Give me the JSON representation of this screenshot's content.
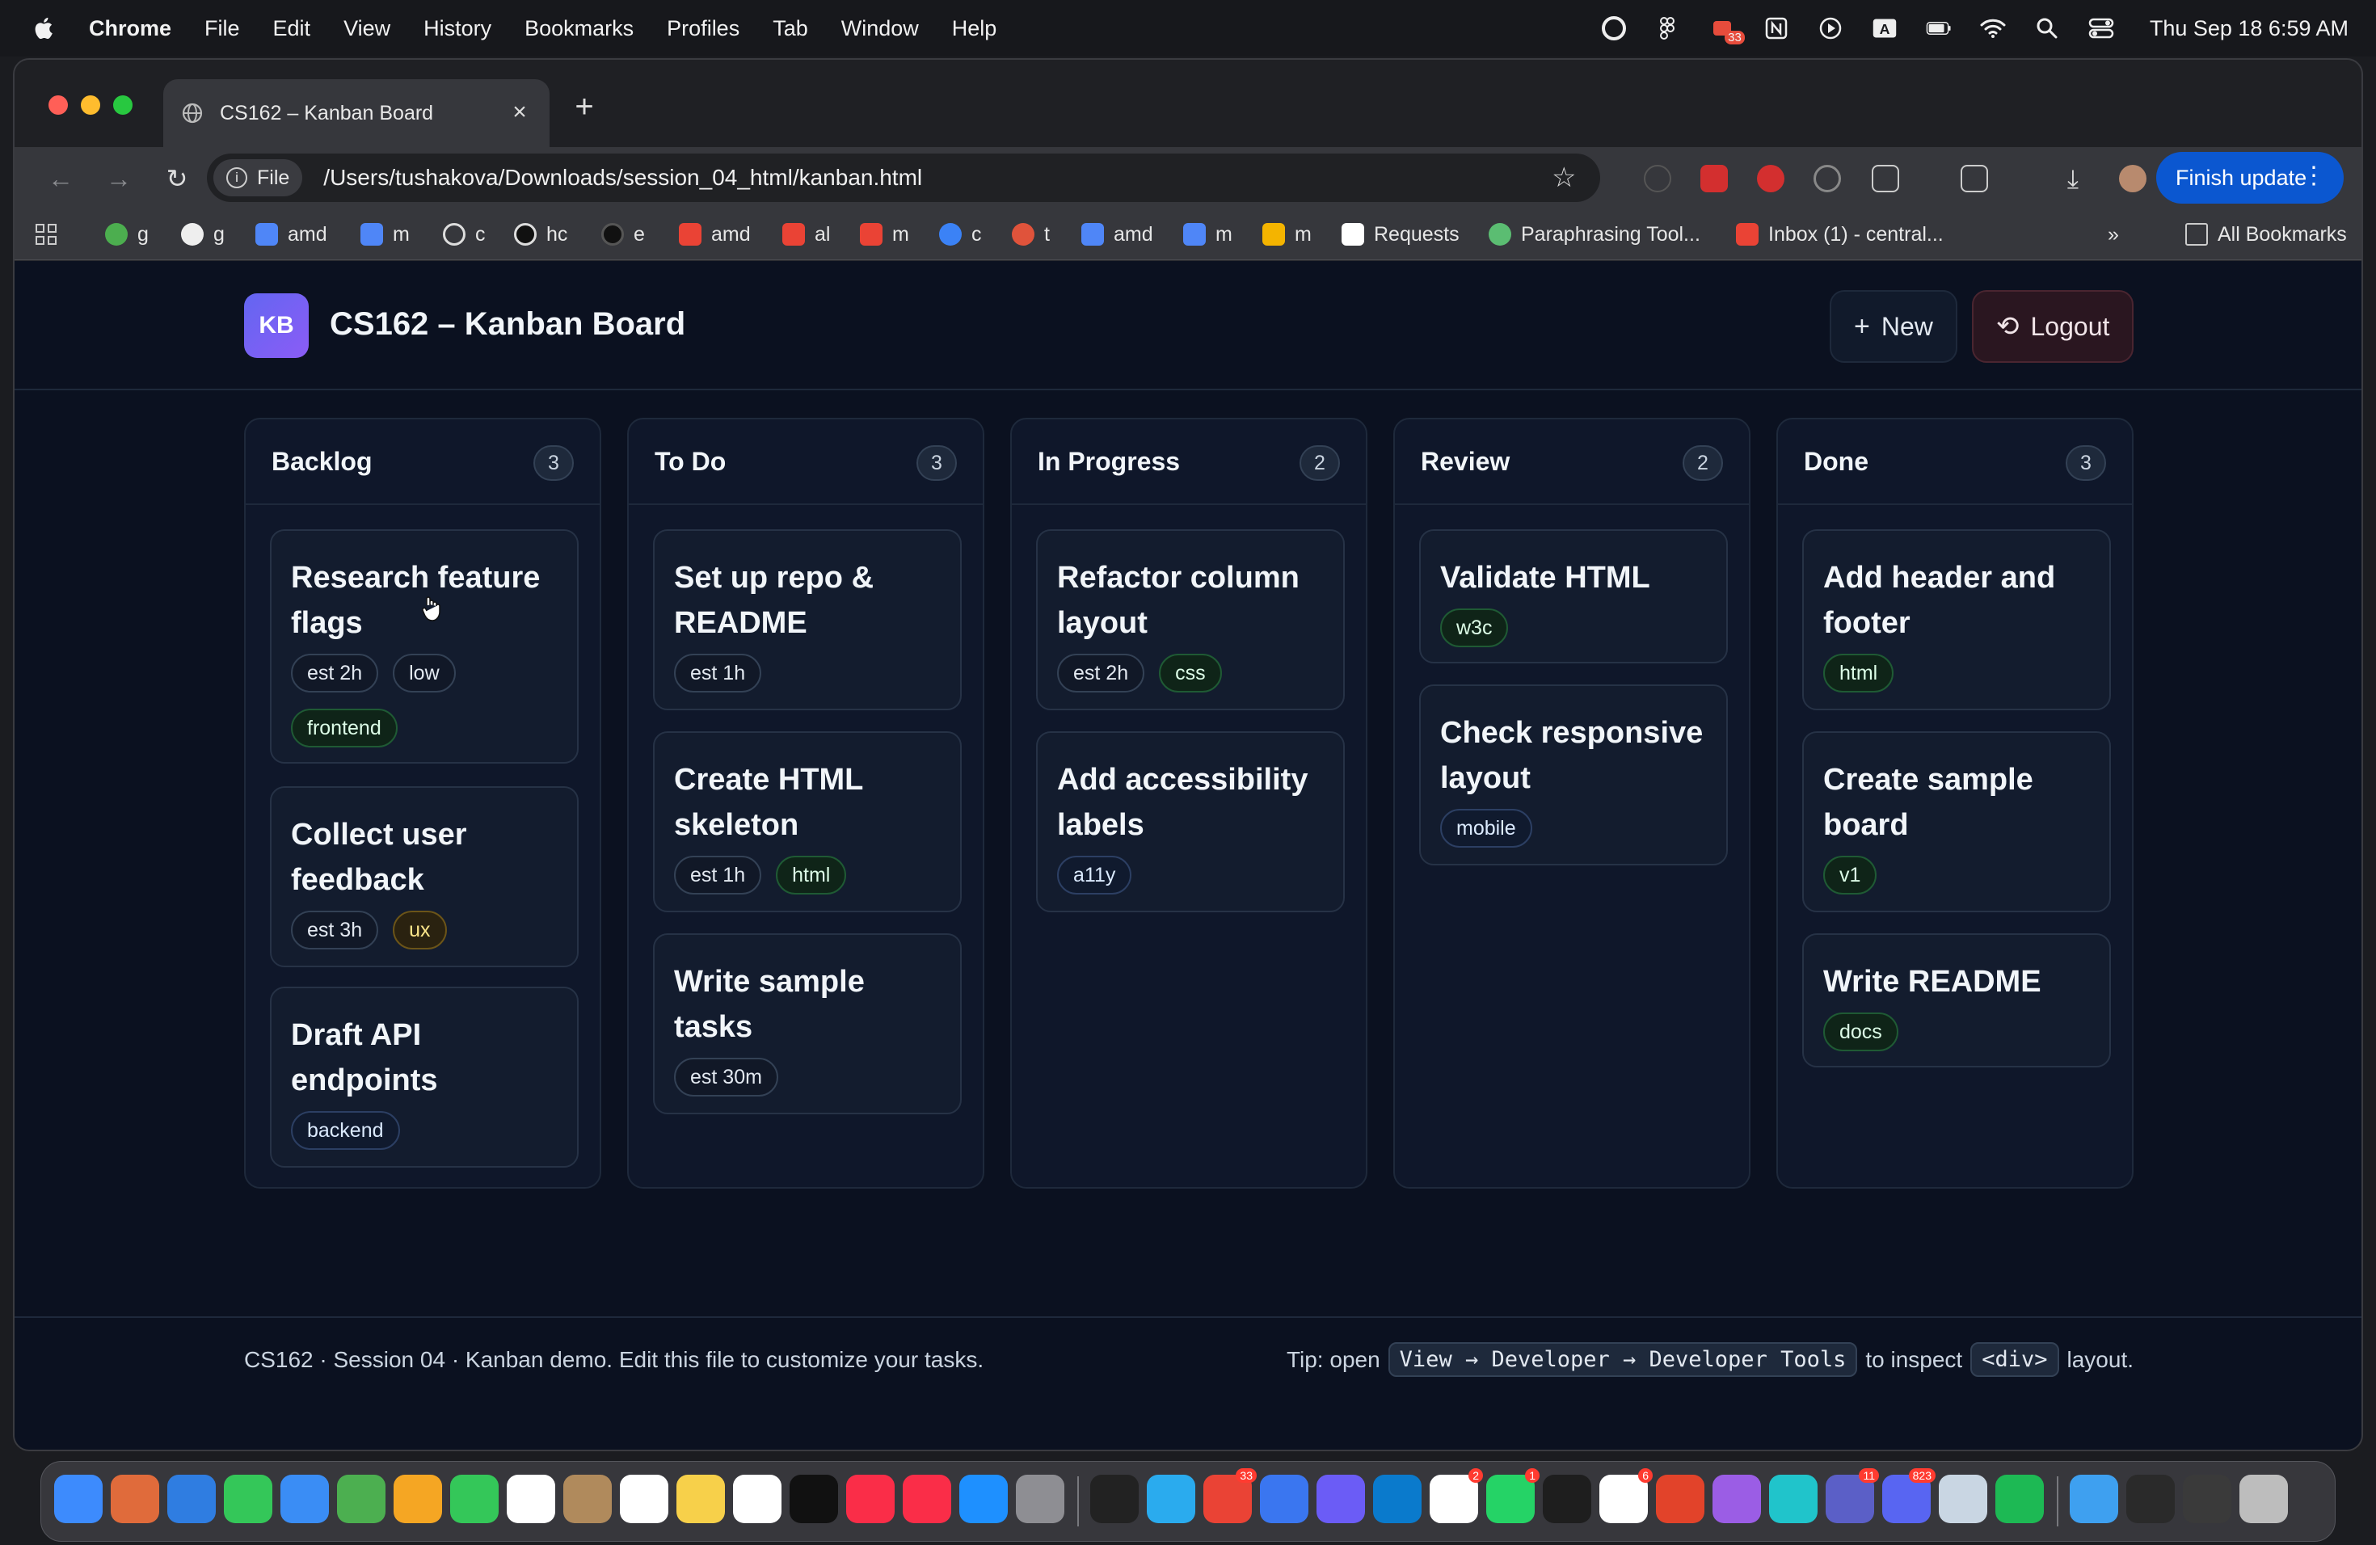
{
  "menubar": {
    "app": "Chrome",
    "items": [
      "File",
      "Edit",
      "View",
      "History",
      "Bookmarks",
      "Profiles",
      "Tab",
      "Window",
      "Help"
    ],
    "clock": "Thu Sep 18  6:59 AM",
    "status_badge": "33"
  },
  "browser": {
    "tab_title": "CS162 – Kanban Board",
    "chip_label": "File",
    "url": "/Users/tushakova/Downloads/session_04_html/kanban.html",
    "finish_update_label": "Finish update",
    "bookmarks": [
      "g",
      "g",
      "amd",
      "m",
      "c",
      "hc",
      "e",
      "amd",
      "al",
      "m",
      "c",
      "t",
      "amd",
      "m",
      "m",
      "Requests",
      "Paraphrasing Tool...",
      "Inbox (1) - central..."
    ],
    "all_bookmarks_label": "All Bookmarks"
  },
  "app": {
    "logo_text": "KB",
    "title": "CS162 – Kanban Board",
    "new_button": "New",
    "logout_button": "Logout"
  },
  "columns": [
    {
      "title": "Backlog",
      "count": "3",
      "cards": [
        {
          "title": "Research feature flags",
          "tags": [
            {
              "text": "est 2h",
              "style": "plain"
            },
            {
              "text": "low",
              "style": "plain"
            },
            {
              "text": "frontend",
              "style": "green"
            }
          ]
        },
        {
          "title": "Collect user feedback",
          "tags": [
            {
              "text": "est 3h",
              "style": "plain"
            },
            {
              "text": "ux",
              "style": "amber"
            }
          ]
        },
        {
          "title": "Draft API endpoints",
          "tags": [
            {
              "text": "backend",
              "style": "blue"
            }
          ]
        }
      ]
    },
    {
      "title": "To Do",
      "count": "3",
      "cards": [
        {
          "title": "Set up repo & README",
          "tags": [
            {
              "text": "est 1h",
              "style": "plain"
            }
          ]
        },
        {
          "title": "Create HTML skeleton",
          "tags": [
            {
              "text": "est 1h",
              "style": "plain"
            },
            {
              "text": "html",
              "style": "green"
            }
          ]
        },
        {
          "title": "Write sample tasks",
          "tags": [
            {
              "text": "est 30m",
              "style": "plain"
            }
          ]
        }
      ]
    },
    {
      "title": "In Progress",
      "count": "2",
      "cards": [
        {
          "title": "Refactor column layout",
          "tags": [
            {
              "text": "est 2h",
              "style": "plain"
            },
            {
              "text": "css",
              "style": "green"
            }
          ]
        },
        {
          "title": "Add accessibility labels",
          "tags": [
            {
              "text": "a11y",
              "style": "blue"
            }
          ]
        }
      ]
    },
    {
      "title": "Review",
      "count": "2",
      "cards": [
        {
          "title": "Validate HTML",
          "tags": [
            {
              "text": "w3c",
              "style": "green"
            }
          ]
        },
        {
          "title": "Check responsive layout",
          "tags": [
            {
              "text": "mobile",
              "style": "blue"
            }
          ]
        }
      ]
    },
    {
      "title": "Done",
      "count": "3",
      "cards": [
        {
          "title": "Add header and footer",
          "tags": [
            {
              "text": "html",
              "style": "green"
            }
          ]
        },
        {
          "title": "Create sample board",
          "tags": [
            {
              "text": "v1",
              "style": "green"
            }
          ]
        },
        {
          "title": "Write README",
          "tags": [
            {
              "text": "docs",
              "style": "green"
            }
          ]
        }
      ]
    }
  ],
  "footer": {
    "text": "CS162 · Session 04 · Kanban demo. Edit this file to customize your tasks.",
    "tip_prefix": "Tip: open",
    "tip_kbd1": "View → Developer → Developer Tools",
    "tip_middle": "to inspect",
    "tip_kbd2": "<div>",
    "tip_suffix": "layout."
  },
  "dock": {
    "badges": [
      "33",
      "2",
      "1",
      "6",
      "11",
      "823"
    ]
  },
  "colors": {
    "page_bg": "#0b1120",
    "column_bg": "#0f172a",
    "card_bg": "#131c2e",
    "logo_gradient_start": "#6366f1",
    "logo_gradient_end": "#8b5cf6",
    "finish_update_bg": "#0b57d0"
  }
}
